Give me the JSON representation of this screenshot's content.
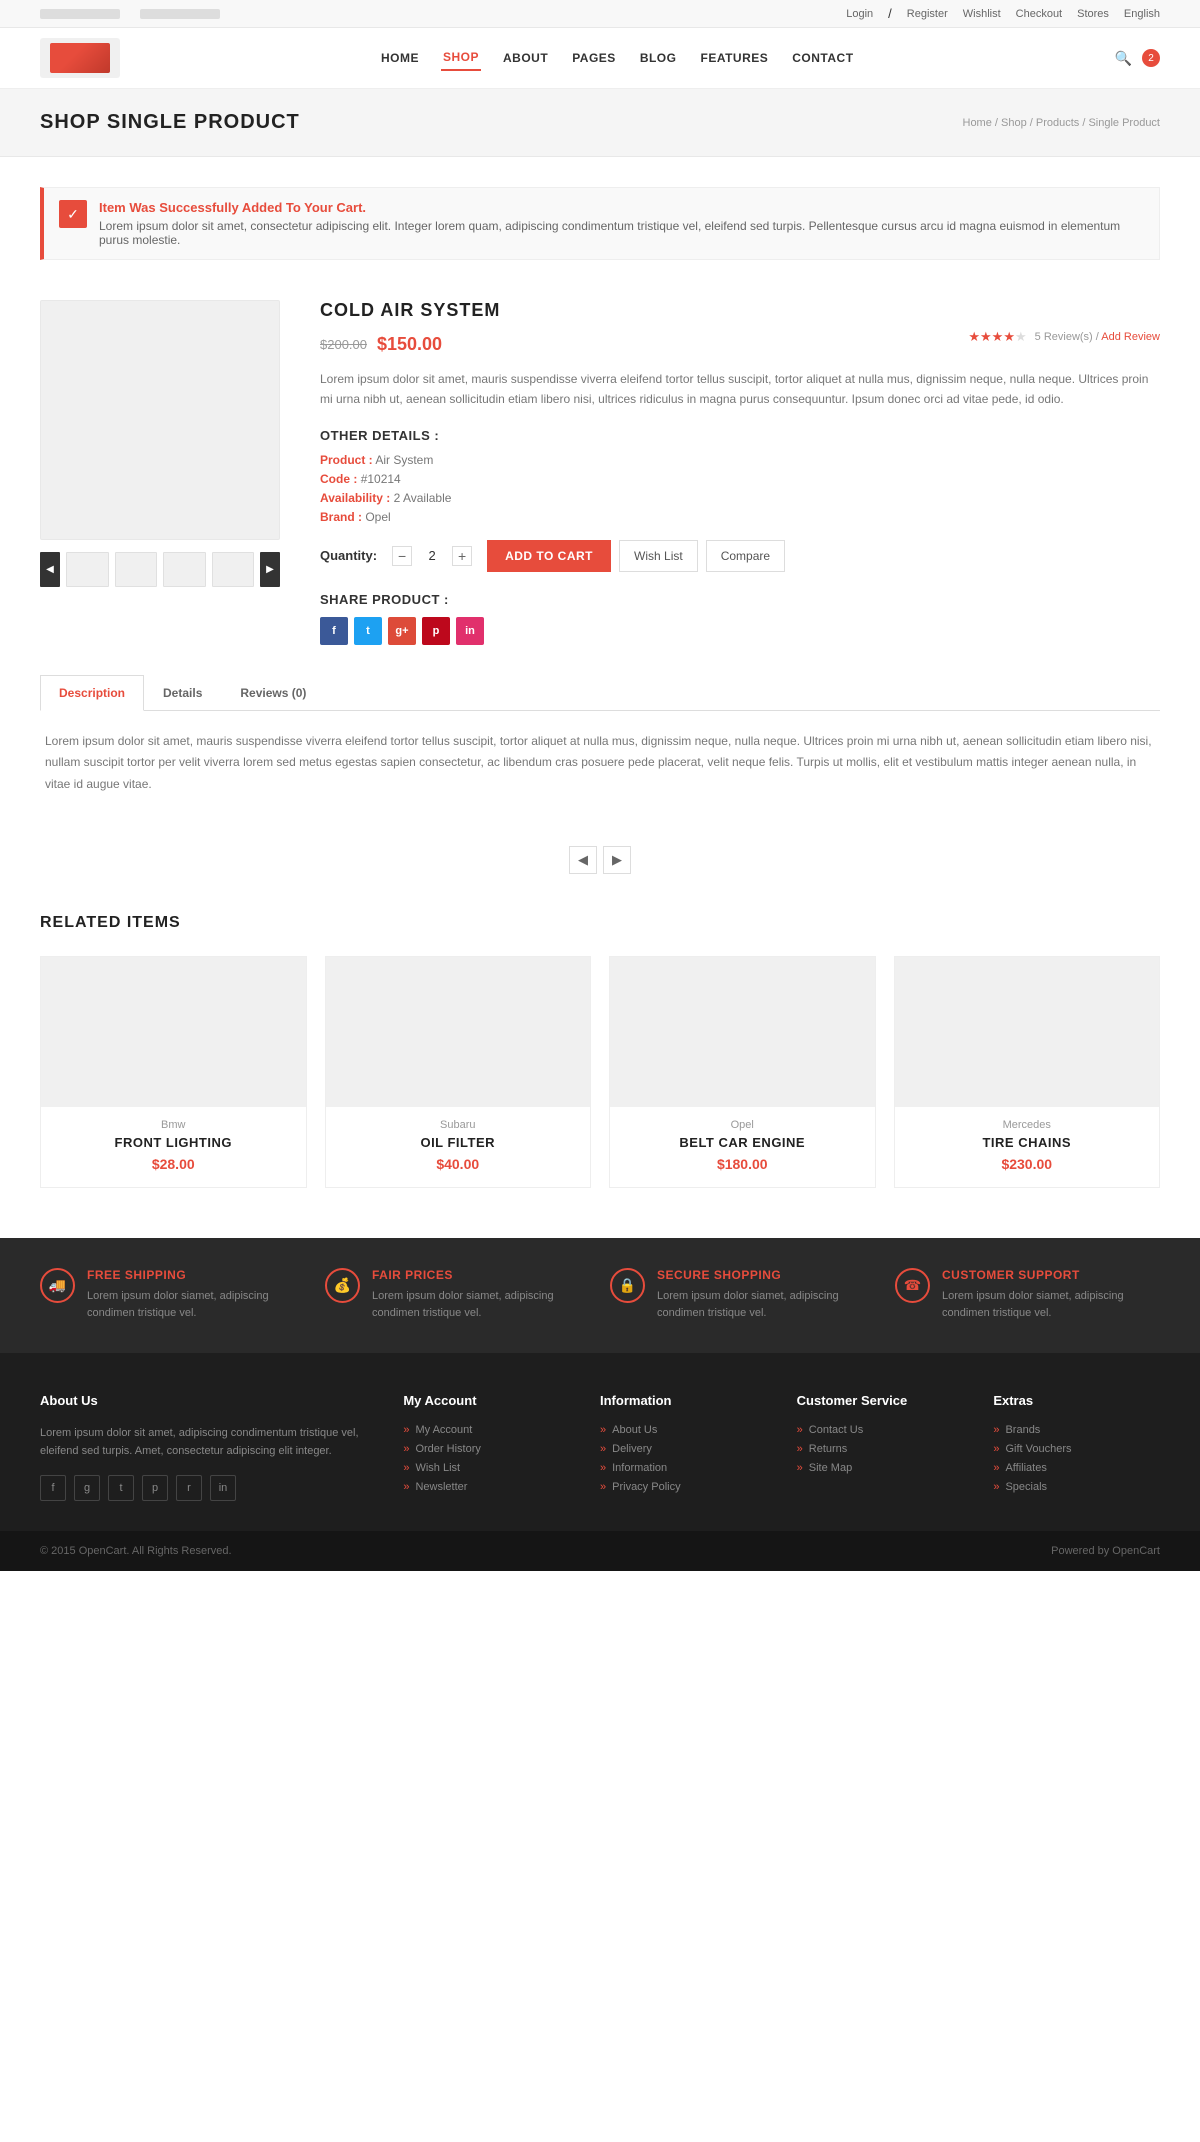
{
  "topbar": {
    "left": {
      "item1": "placeholder text",
      "item2": "placeholder text"
    },
    "right": {
      "login": "Login",
      "slash": "/",
      "register": "Register",
      "wishlist": "Wishlist",
      "checkout": "Checkout",
      "stores": "Stores",
      "language": "English"
    }
  },
  "nav": {
    "links": [
      {
        "label": "HOME",
        "active": false
      },
      {
        "label": "SHOP",
        "active": true
      },
      {
        "label": "ABOUT",
        "active": false
      },
      {
        "label": "PAGES",
        "active": false
      },
      {
        "label": "BLOG",
        "active": false
      },
      {
        "label": "FEATURES",
        "active": false
      },
      {
        "label": "CONTACT",
        "active": false
      }
    ],
    "cart_count": "2"
  },
  "page_header": {
    "title": "SHOP SINGLE PRODUCT",
    "breadcrumb": "Home / Shop / Products / Single Product"
  },
  "alert": {
    "icon": "✓",
    "title": "Item Was Successfully Added To Your Cart.",
    "text": "Lorem ipsum dolor sit amet, consectetur adipiscing elit. Integer lorem quam, adipiscing condimentum tristique vel, eleifend sed turpis. Pellentesque cursus arcu id magna euismod in elementum purus molestie."
  },
  "product": {
    "name": "COLD AIR SYSTEM",
    "price_old": "$200.00",
    "price_new": "$150.00",
    "stars": 4.5,
    "review_count": "5 Review(s)",
    "add_review": "Add Review",
    "description": "Lorem ipsum dolor sit amet, mauris suspendisse viverra eleifend tortor tellus suscipit, tortor aliquet at nulla mus, dignissim neque, nulla neque. Ultrices proin mi urna nibh ut, aenean sollicitudin etiam libero nisi, ultrices ridiculus in magna purus consequuntur. Ipsum donec orci ad vitae pede, id odio.",
    "other_details_title": "OTHER DETAILS :",
    "details": [
      {
        "label": "Product :",
        "value": "Air System"
      },
      {
        "label": "Code :",
        "value": "#10214"
      },
      {
        "label": "Availability :",
        "value": "2 Available"
      },
      {
        "label": "Brand :",
        "value": "Opel"
      }
    ],
    "quantity_label": "Quantity:",
    "quantity": "2",
    "btn_add_cart": "Add To Cart",
    "btn_wish": "Wish List",
    "btn_compare": "Compare",
    "share_title": "SHARE PRODUCT :"
  },
  "tabs": [
    {
      "label": "Description",
      "active": true
    },
    {
      "label": "Details",
      "active": false
    },
    {
      "label": "Reviews (0)",
      "active": false
    }
  ],
  "tab_content": "Lorem ipsum dolor sit amet, mauris suspendisse viverra eleifend tortor tellus suscipit, tortor aliquet at nulla mus, dignissim neque, nulla neque. Ultrices proin mi urna nibh ut, aenean sollicitudin etiam libero nisi, nullam suscipit tortor per velit viverra lorem sed metus egestas sapien consectetur, ac libendum cras posuere pede placerat, velit neque felis. Turpis ut mollis, elit et vestibulum mattis integer aenean nulla, in vitae id augue vitae.",
  "related": {
    "title": "RELATED ITEMS",
    "items": [
      {
        "brand": "Bmw",
        "name": "FRONT LIGHTING",
        "price": "$28.00"
      },
      {
        "brand": "Subaru",
        "name": "OIL FILTER",
        "price": "$40.00"
      },
      {
        "brand": "Opel",
        "name": "BELT CAR ENGINE",
        "price": "$180.00"
      },
      {
        "brand": "Mercedes",
        "name": "TIRE CHAINS",
        "price": "$230.00"
      }
    ]
  },
  "footer_features": [
    {
      "icon": "🚚",
      "title": "FREE SHIPPING",
      "text": "Lorem ipsum dolor siamet, adipiscing condimen tristique vel."
    },
    {
      "icon": "💰",
      "title": "FAIR PRICES",
      "text": "Lorem ipsum dolor siamet, adipiscing condimen tristique vel."
    },
    {
      "icon": "🔒",
      "title": "SECURE SHOPPING",
      "text": "Lorem ipsum dolor siamet, adipiscing condimen tristique vel."
    },
    {
      "icon": "☎",
      "title": "CUSTOMER SUPPORT",
      "text": "Lorem ipsum dolor siamet, adipiscing condimen tristique vel."
    }
  ],
  "footer": {
    "about": {
      "title": "About Us",
      "text": "Lorem ipsum dolor sit amet, adipiscing condimentum tristique vel, eleifend sed turpis. Amet, consectetur adipiscing elit integer."
    },
    "my_account": {
      "title": "My Account",
      "links": [
        "MY ACCOUNT",
        "ORDER HISTORY",
        "WISH LIST",
        "NEWSLETTER"
      ]
    },
    "information": {
      "title": "Information",
      "links": [
        "ABOUT US",
        "DELIVERY",
        "INFORMATION",
        "PRIVACY POLICY"
      ]
    },
    "customer_service": {
      "title": "Customer Service",
      "links": [
        "CONTACT US",
        "RETURNS",
        "SITE MAP"
      ]
    },
    "extras": {
      "title": "Extras",
      "links": [
        "BRANDS",
        "GIFT VOUCHERS",
        "AFFILIATES",
        "SPECIALS"
      ]
    }
  },
  "footer_bottom": {
    "copyright": "© 2015 OpenCart. All Rights Reserved.",
    "powered": "Powered by OpenCart"
  }
}
